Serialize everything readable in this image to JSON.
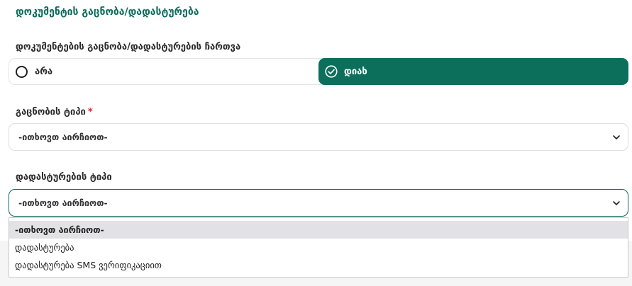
{
  "section_title": "დოკუმენტის გაცნობა/დადასტურება",
  "toggle": {
    "label": "დოკუმენტების გაცნობა/დადასტურების ჩართვა",
    "options": [
      "არა",
      "დიახ"
    ],
    "selected": "დიახ",
    "accent_color": "#0b6f5c"
  },
  "familiarization_type": {
    "label": "გაცნობის ტიპი",
    "required_mark": "*",
    "value": "-ითხოვთ აირჩიოთ-"
  },
  "confirmation_type": {
    "label": "დადასტურების ტიპი",
    "value": "-ითხოვთ აირჩიოთ-",
    "options": [
      "-ითხოვთ აირჩიოთ-",
      "დადასტურება",
      "დადასტურება SMS ვერიფიკაციით"
    ],
    "highlighted_index": 0
  },
  "icons": {
    "radio": "radio-unchecked-icon",
    "check": "check-circle-icon",
    "chevron": "chevron-down-icon"
  }
}
